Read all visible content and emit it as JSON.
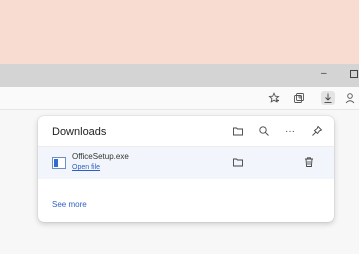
{
  "browser": {
    "window_controls": {
      "minimize_label": "–"
    },
    "toolbar": {
      "icons": [
        "favorites-star-icon",
        "collections-icon",
        "downloads-icon",
        "profile-icon"
      ]
    }
  },
  "downloads_panel": {
    "title": "Downloads",
    "header_icons": [
      "open-folder-icon",
      "search-icon",
      "more-options-icon",
      "pin-icon"
    ],
    "more_label": "···",
    "items": [
      {
        "file_name": "OfficeSetup.exe",
        "action_label": "Open file"
      }
    ],
    "see_more_label": "See more"
  },
  "colors": {
    "banner": "#f8dcd2",
    "title_bar": "#d4d4d4",
    "link": "#2f5fc4",
    "item_highlight": "#f2f5fb"
  }
}
